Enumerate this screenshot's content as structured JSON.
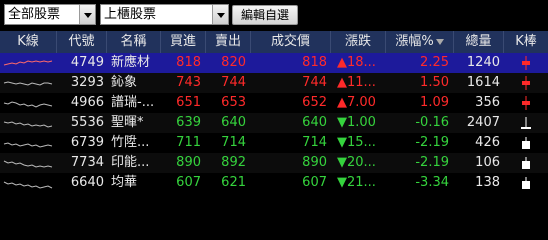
{
  "toolbar": {
    "category_select": "全部股票",
    "market_select": "上櫃股票",
    "edit_button": "編輯自選"
  },
  "columns": [
    "K線",
    "代號",
    "名稱",
    "買進",
    "賣出",
    "成交價",
    "漲跌",
    "漲幅%",
    "總量",
    "K棒"
  ],
  "colors": {
    "up": "#ff2a2a",
    "down": "#35d33d",
    "header_bg": "#21325c",
    "selected_bg": "#1d1a9b"
  },
  "rows": [
    {
      "code": "4749",
      "name": "新應材",
      "bid": "818",
      "ask": "820",
      "price": "818",
      "change": "▲18...",
      "pct": "2.25",
      "vol": "1240",
      "dir": "up",
      "selected": true,
      "kbar": "red-cross"
    },
    {
      "code": "3293",
      "name": "鈊象",
      "bid": "743",
      "ask": "744",
      "price": "744",
      "change": "▲11...",
      "pct": "1.50",
      "vol": "1614",
      "dir": "up",
      "selected": false,
      "kbar": "red-cross"
    },
    {
      "code": "4966",
      "name": "譜瑞-...",
      "bid": "651",
      "ask": "653",
      "price": "652",
      "change": "▲7.00",
      "pct": "1.09",
      "vol": "356",
      "dir": "up",
      "selected": false,
      "kbar": "red-cross"
    },
    {
      "code": "5536",
      "name": "聖暉*",
      "bid": "639",
      "ask": "640",
      "price": "640",
      "change": "▼1.00",
      "pct": "-0.16",
      "vol": "2407",
      "dir": "down",
      "selected": false,
      "kbar": "white-t"
    },
    {
      "code": "6739",
      "name": "竹陞...",
      "bid": "711",
      "ask": "714",
      "price": "714",
      "change": "▼15...",
      "pct": "-2.19",
      "vol": "426",
      "dir": "down",
      "selected": false,
      "kbar": "white-box"
    },
    {
      "code": "7734",
      "name": "印能...",
      "bid": "890",
      "ask": "892",
      "price": "890",
      "change": "▼20...",
      "pct": "-2.19",
      "vol": "106",
      "dir": "down",
      "selected": false,
      "kbar": "white-box"
    },
    {
      "code": "6640",
      "name": "均華",
      "bid": "607",
      "ask": "621",
      "price": "607",
      "change": "▼21...",
      "pct": "-3.34",
      "vol": "138",
      "dir": "down",
      "selected": false,
      "kbar": "white-box"
    }
  ]
}
